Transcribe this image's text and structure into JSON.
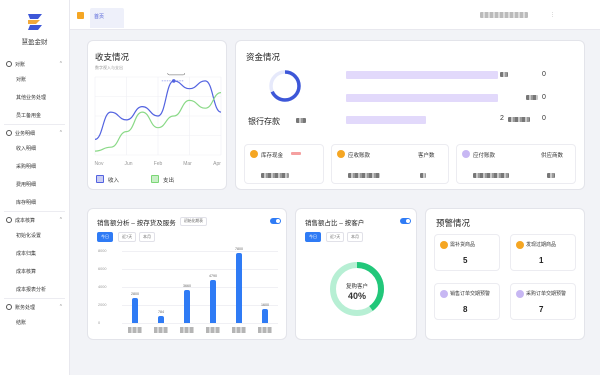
{
  "app": {
    "name": "慧盈金财"
  },
  "sidebar": {
    "groups": [
      {
        "label": "对账",
        "items": [
          "对账",
          "其他业务处理",
          "员工备用金"
        ]
      },
      {
        "label": "业务明细",
        "items": [
          "收入明细",
          "采购明细",
          "费用明细",
          "库存明细"
        ]
      },
      {
        "label": "成本核算",
        "items": [
          "初始化设置",
          "成本归集",
          "成本核算",
          "成本报表分析"
        ]
      },
      {
        "label": "账务处理",
        "items": [
          "结账"
        ]
      }
    ]
  },
  "topbar": {
    "tab_home": "首页"
  },
  "income_expense": {
    "title": "收支情况",
    "subtitle": "数字视入与支出",
    "tooltip": "12.50",
    "legend_income": "收入",
    "legend_expense": "支出"
  },
  "funds": {
    "title": "资金情况",
    "bank_label": "银行存款",
    "row_values": [
      "0",
      "0",
      "0"
    ],
    "row_prefix": "2",
    "inventory_label": "库存现金",
    "receivable_label": "应收账款",
    "customer_count_label": "客户数",
    "payable_label": "应付账款",
    "supplier_count_label": "供应商数"
  },
  "sales_analysis": {
    "title": "销售额分析 – 按存货及服务",
    "tag": "初始化期表",
    "tabs": [
      "今日",
      "近7天",
      "本月"
    ],
    "active_tab": "今日"
  },
  "sales_share": {
    "title": "销售额占比 – 按客户",
    "tabs": [
      "今日",
      "近7天",
      "本月"
    ],
    "active_tab": "今日",
    "donut_label": "复购客户",
    "donut_value": "40%"
  },
  "warnings": {
    "title": "预警情况",
    "items": [
      {
        "label": "需补货商品",
        "value": "5"
      },
      {
        "label": "发现过期商品",
        "value": "1"
      },
      {
        "label": "销售订单交期预警",
        "value": "8"
      },
      {
        "label": "采购订单交期预警",
        "value": "7"
      }
    ]
  },
  "colors": {
    "accent": "#2f7bf5",
    "purple": "#e2d9fb",
    "green": "#22c77a"
  },
  "chart_data": [
    {
      "type": "line",
      "title": "收支情况",
      "categories": [
        "Nov",
        "Jun",
        "Feb",
        "Mar",
        "Apr"
      ],
      "series": [
        {
          "name": "收入",
          "values": [
            0.2,
            0.55,
            0.45,
            0.62,
            0.5,
            0.95,
            0.85,
            0.95,
            0.55
          ]
        },
        {
          "name": "支出",
          "values": [
            0.05,
            0.1,
            0.3,
            0.55,
            0.35,
            0.5,
            0.7,
            0.6,
            0.8
          ]
        }
      ],
      "grid": true,
      "legend": "bottom-left"
    },
    {
      "type": "bar",
      "title": "销售额分析 – 按存货及服务",
      "yticks": [
        "8000",
        "6000",
        "4000",
        "2000",
        "0"
      ],
      "ylim": [
        0,
        8000
      ],
      "values": [
        2800,
        784,
        3660,
        4790,
        7800,
        1600
      ],
      "value_labels": [
        "2800",
        "784",
        "3660",
        "4790",
        "7800",
        "1600"
      ]
    },
    {
      "type": "pie",
      "title": "销售额占比 – 按客户",
      "slices": [
        {
          "name": "复购客户",
          "value": 40
        },
        {
          "name": "",
          "value": 60
        }
      ]
    }
  ]
}
